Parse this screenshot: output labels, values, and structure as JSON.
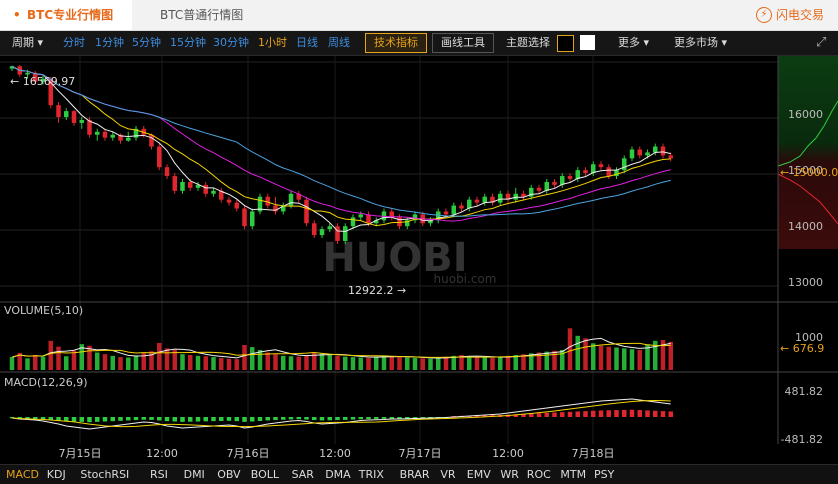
{
  "tabs": {
    "active": "BTC专业行情图",
    "other": "BTC普通行情图"
  },
  "brand": {
    "name": "闪电交易",
    "icon": "lightning-icon"
  },
  "toolbar": {
    "period_label": "周期",
    "intervals": [
      "分时",
      "1分钟",
      "5分钟",
      "15分钟",
      "30分钟",
      "1小时",
      "日线",
      "周线"
    ],
    "active_interval": "1小时",
    "tech_button": "技术指标",
    "draw_button": "画线工具",
    "theme_label": "主题选择",
    "theme_colors": [
      "#000000",
      "#ffffff"
    ],
    "more_label": "更多",
    "more_market_label": "更多市场",
    "more_icon": "caret-down-icon",
    "expand_icon": "expand-arrows-icon"
  },
  "main": {
    "price_ticks": [
      "16000",
      "15000",
      "14000",
      "13000"
    ],
    "high_label": "← 16569.97",
    "low_label": "12922.2 →",
    "current_price": "15000.03",
    "watermark": "huobi.com"
  },
  "volume": {
    "title": "VOLUME(5,10)",
    "tick": "1000",
    "current": "676.9"
  },
  "macd": {
    "title": "MACD(12,26,9)",
    "top_tick": "481.82",
    "bottom_tick": "-481.82"
  },
  "time_labels": [
    "7月15日",
    "12:00",
    "7月16日",
    "12:00",
    "7月17日",
    "12:00",
    "7月18日"
  ],
  "indicators": [
    "MACD",
    "KDJ",
    "StochRSI",
    "RSI",
    "DMI",
    "OBV",
    "BOLL",
    "SAR",
    "DMA",
    "TRIX",
    "BRAR",
    "VR",
    "EMV",
    "WR",
    "ROC",
    "MTM",
    "PSY"
  ],
  "active_indicator": "MACD",
  "colors": {
    "up": "#2ecc40",
    "down": "#e0262e",
    "accent": "#e6a21a",
    "ma1": "#f0f0f0",
    "ma2": "#f5d400",
    "ma3": "#e020e0",
    "ma4": "#4aa3df"
  },
  "chart_data": {
    "type": "candlestick",
    "y_range": [
      12600,
      16700
    ],
    "candles": [
      [
        16520,
        16560,
        16480,
        16570
      ],
      [
        16560,
        16420,
        16380,
        16580
      ],
      [
        16420,
        16450,
        16350,
        16500
      ],
      [
        16450,
        16300,
        16250,
        16480
      ],
      [
        16300,
        16350,
        16250,
        16400
      ],
      [
        16350,
        15900,
        15850,
        16380
      ],
      [
        15900,
        15700,
        15600,
        15950
      ],
      [
        15700,
        15800,
        15650,
        15850
      ],
      [
        15800,
        15600,
        15550,
        15820
      ],
      [
        15600,
        15650,
        15500,
        15700
      ],
      [
        15650,
        15400,
        15350,
        15700
      ],
      [
        15400,
        15450,
        15300,
        15500
      ],
      [
        15450,
        15350,
        15300,
        15500
      ],
      [
        15350,
        15400,
        15300,
        15450
      ],
      [
        15400,
        15300,
        15250,
        15420
      ],
      [
        15300,
        15350,
        15280,
        15450
      ],
      [
        15350,
        15500,
        15300,
        15550
      ],
      [
        15500,
        15400,
        15350,
        15550
      ],
      [
        15400,
        15200,
        15150,
        15420
      ],
      [
        15200,
        14850,
        14800,
        15250
      ],
      [
        14850,
        14700,
        14650,
        14900
      ],
      [
        14700,
        14450,
        14400,
        14750
      ],
      [
        14450,
        14600,
        14400,
        14650
      ],
      [
        14600,
        14500,
        14450,
        14650
      ],
      [
        14500,
        14550,
        14450,
        14600
      ],
      [
        14550,
        14400,
        14350,
        14600
      ],
      [
        14400,
        14450,
        14350,
        14500
      ],
      [
        14450,
        14300,
        14250,
        14500
      ],
      [
        14300,
        14250,
        14200,
        14350
      ],
      [
        14250,
        14150,
        14100,
        14300
      ],
      [
        14150,
        13850,
        13800,
        14200
      ],
      [
        13850,
        14100,
        13800,
        14150
      ],
      [
        14100,
        14350,
        14050,
        14400
      ],
      [
        14350,
        14200,
        14150,
        14400
      ],
      [
        14200,
        14100,
        14050,
        14350
      ],
      [
        14100,
        14200,
        14050,
        14250
      ],
      [
        14200,
        14400,
        14150,
        14450
      ],
      [
        14400,
        14300,
        14250,
        14450
      ],
      [
        14300,
        13900,
        13850,
        14350
      ],
      [
        13900,
        13700,
        13650,
        13950
      ],
      [
        13700,
        13800,
        13650,
        13850
      ],
      [
        13800,
        13850,
        13750,
        13900
      ],
      [
        13850,
        13600,
        13550,
        13900
      ],
      [
        13600,
        13850,
        13550,
        13900
      ],
      [
        13850,
        14000,
        13800,
        14050
      ],
      [
        14000,
        14050,
        13950,
        14100
      ],
      [
        14050,
        13900,
        13850,
        14100
      ],
      [
        13900,
        13950,
        13850,
        14000
      ],
      [
        13950,
        14100,
        13900,
        14150
      ],
      [
        14100,
        14000,
        13950,
        14150
      ],
      [
        14000,
        13850,
        13800,
        14050
      ],
      [
        13850,
        13950,
        13800,
        14000
      ],
      [
        13950,
        14050,
        13900,
        14100
      ],
      [
        14050,
        13900,
        13850,
        14100
      ],
      [
        13900,
        13950,
        13850,
        14000
      ],
      [
        13950,
        14100,
        13900,
        14150
      ],
      [
        14100,
        14050,
        14000,
        14150
      ],
      [
        14050,
        14200,
        14000,
        14250
      ],
      [
        14200,
        14150,
        14100,
        14250
      ],
      [
        14150,
        14300,
        14100,
        14350
      ],
      [
        14300,
        14250,
        14200,
        14350
      ],
      [
        14250,
        14350,
        14200,
        14400
      ],
      [
        14350,
        14250,
        14200,
        14400
      ],
      [
        14250,
        14400,
        14200,
        14450
      ],
      [
        14400,
        14300,
        14250,
        14450
      ],
      [
        14300,
        14400,
        14250,
        14500
      ],
      [
        14400,
        14350,
        14300,
        14450
      ],
      [
        14350,
        14500,
        14300,
        14550
      ],
      [
        14500,
        14450,
        14400,
        14550
      ],
      [
        14450,
        14600,
        14400,
        14650
      ],
      [
        14600,
        14550,
        14500,
        14650
      ],
      [
        14550,
        14700,
        14500,
        14750
      ],
      [
        14700,
        14650,
        14600,
        14750
      ],
      [
        14650,
        14800,
        14600,
        14850
      ],
      [
        14800,
        14750,
        14700,
        14850
      ],
      [
        14750,
        14900,
        14700,
        14950
      ],
      [
        14900,
        14850,
        14800,
        14950
      ],
      [
        14850,
        14700,
        14650,
        14900
      ],
      [
        14700,
        14800,
        14650,
        14850
      ],
      [
        14800,
        15000,
        14750,
        15050
      ],
      [
        15000,
        15150,
        14950,
        15200
      ],
      [
        15150,
        15050,
        15000,
        15200
      ],
      [
        15050,
        15100,
        15000,
        15150
      ],
      [
        15100,
        15200,
        15050,
        15250
      ],
      [
        15200,
        15050,
        15000,
        15250
      ],
      [
        15050,
        15000,
        14950,
        15100
      ]
    ],
    "volumes": [
      310,
      410,
      280,
      360,
      320,
      700,
      560,
      330,
      460,
      620,
      580,
      420,
      380,
      340,
      310,
      300,
      350,
      400,
      450,
      650,
      520,
      480,
      380,
      360,
      340,
      330,
      310,
      290,
      270,
      260,
      600,
      550,
      480,
      420,
      380,
      340,
      330,
      320,
      360,
      420,
      390,
      360,
      340,
      320,
      310,
      300,
      290,
      320,
      350,
      330,
      310,
      300,
      290,
      280,
      270,
      300,
      320,
      340,
      360,
      330,
      310,
      300,
      290,
      320,
      340,
      360,
      380,
      400,
      420,
      440,
      460,
      480,
      1000,
      820,
      760,
      640,
      580,
      560,
      540,
      520,
      500,
      480,
      620,
      700,
      720,
      676.9
    ],
    "macd": [
      -10,
      -20,
      -25,
      -30,
      -40,
      -55,
      -70,
      -90,
      -100,
      -110,
      -120,
      -110,
      -100,
      -90,
      -80,
      -70,
      -60,
      -50,
      -55,
      -70,
      -90,
      -100,
      -110,
      -105,
      -100,
      -95,
      -90,
      -85,
      -80,
      -90,
      -110,
      -100,
      -85,
      -70,
      -60,
      -50,
      -40,
      -35,
      -45,
      -60,
      -70,
      -65,
      -60,
      -55,
      -45,
      -35,
      -30,
      -28,
      -25,
      -20,
      -20,
      -18,
      -15,
      -12,
      -10,
      -8,
      -5,
      0,
      5,
      10,
      15,
      20,
      25,
      30,
      40,
      50,
      60,
      70,
      80,
      90,
      100,
      110,
      120,
      130,
      140,
      150,
      160,
      165,
      170,
      175,
      180,
      170,
      160,
      150,
      140,
      130
    ]
  }
}
